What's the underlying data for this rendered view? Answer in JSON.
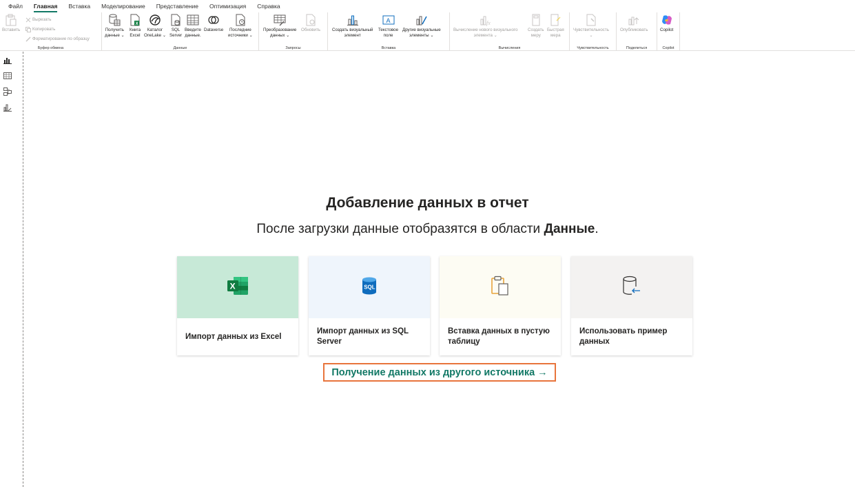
{
  "tabs": [
    "Файл",
    "Главная",
    "Вставка",
    "Моделирование",
    "Представление",
    "Оптимизация",
    "Справка"
  ],
  "active_tab": "Главная",
  "ribbon": {
    "clipboard": {
      "label": "Буфер обмена",
      "paste": "Вставить",
      "cut": "Вырезать",
      "copy": "Копировать",
      "format_painter": "Форматирование по образцу"
    },
    "data": {
      "label": "Данные",
      "get_data": [
        "Получить",
        "данные ⌄"
      ],
      "excel": [
        "Книга",
        "Excel"
      ],
      "onelake": [
        "Каталог",
        "OneLake ⌄"
      ],
      "sql": [
        "SQL",
        "Server"
      ],
      "enter_data": [
        "Введите",
        "данные."
      ],
      "dataverse": [
        "Dataverse"
      ],
      "recent": [
        "Последние",
        "источники ⌄"
      ]
    },
    "queries": {
      "label": "Запросы",
      "transform": [
        "Преобразование",
        "данных ⌄"
      ],
      "refresh": [
        "Обновить"
      ]
    },
    "insert": {
      "label": "Вставка",
      "new_visual": [
        "Создать визуальный",
        "элемент"
      ],
      "text_box": [
        "Текстовое",
        "поле"
      ],
      "more_visuals": [
        "Другие визуальные",
        "элементы ⌄"
      ]
    },
    "calculations": {
      "label": "Вычисления",
      "visual_calc": [
        "Вычисление нового визуального",
        "элемента ⌄"
      ],
      "new_measure": [
        "Создать",
        "меру"
      ],
      "quick_measure": [
        "Быстрая",
        "мера"
      ]
    },
    "sensitivity": {
      "label": "Чувствительность",
      "sensitivity": [
        "Чувствительность",
        "⌄"
      ]
    },
    "share": {
      "label": "Поделиться",
      "publish": [
        "Опубликовать"
      ]
    },
    "copilot": {
      "label": "Copilot",
      "copilot": [
        "Copilot"
      ]
    }
  },
  "main": {
    "title": "Добавление данных в отчет",
    "subtitle_prefix": "После загрузки данные отобразятся в области ",
    "subtitle_bold": "Данные",
    "subtitle_suffix": ".",
    "cards": [
      {
        "label": "Импорт данных из Excel",
        "bg": "#c7e9d7"
      },
      {
        "label": "Импорт данных из SQL Server",
        "bg": "#eff5fc"
      },
      {
        "label": "Вставка данных в пустую таблицу",
        "bg": "#fdfcf3"
      },
      {
        "label": "Использовать пример данных",
        "bg": "#f3f2f1"
      }
    ],
    "other_source_link": "Получение данных из другого источника →"
  },
  "colors": {
    "accent": "#117865",
    "link_border": "#e8743b"
  }
}
